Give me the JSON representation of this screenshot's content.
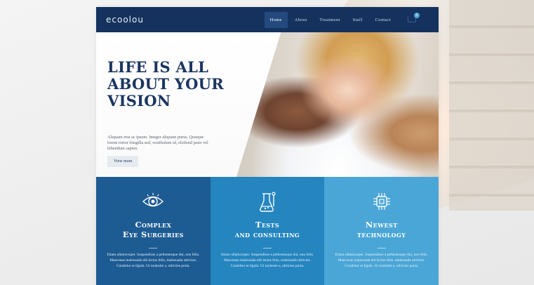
{
  "brand": {
    "logo": "ecoolou"
  },
  "nav": {
    "items": [
      "Home",
      "About",
      "Treatment",
      "Staff",
      "Contact"
    ],
    "active": "Home"
  },
  "cart": {
    "count": "0",
    "total": ""
  },
  "hero": {
    "title_lines": [
      "LIFE IS ALL",
      "ABOUT YOUR",
      "VISION"
    ],
    "text": "Aliquam erat ac ipsum. Integer aliquam purus. Quisque lorem tortor fringilla sed, vestibulum id, eleifend justo vel bibendum sapien.",
    "button": "View more"
  },
  "features": [
    {
      "icon": "eye-icon",
      "title_lines": [
        "Complex",
        "Eye Surgeries"
      ],
      "text": "Etiam ullamcorper. Suspendisse a pellentesque dui, non felis. Maecenas malesuada elit lectus felis, malesuada ultricies. Curabitur et ligula. Ut molestie a, ultricies porta."
    },
    {
      "icon": "lab-tests-icon",
      "title_lines": [
        "Tests",
        "and consulting"
      ],
      "text": "Etiam ullamcorper. Suspendisse a pellentesque dui, non felis. Maecenas malesuada elit lectus felis, malesuada ultricies. Curabitur et ligula. Ut molestie a, ultricies porta."
    },
    {
      "icon": "chip-icon",
      "title_lines": [
        "Newest",
        "technology"
      ],
      "text": "Etiam ullamcorper. Suspendisse a pellentesque dui, non felis. Maecenas malesuada elit lectus felis, malesuada ultricies. Curabitur et ligula. Ut molestie a, ultricies porta."
    }
  ],
  "colors": {
    "navbar": "#15325e",
    "title": "#1a3561",
    "feature_1": "#1d5b93",
    "feature_2": "#2485bf",
    "feature_3": "#4aa6d6"
  }
}
